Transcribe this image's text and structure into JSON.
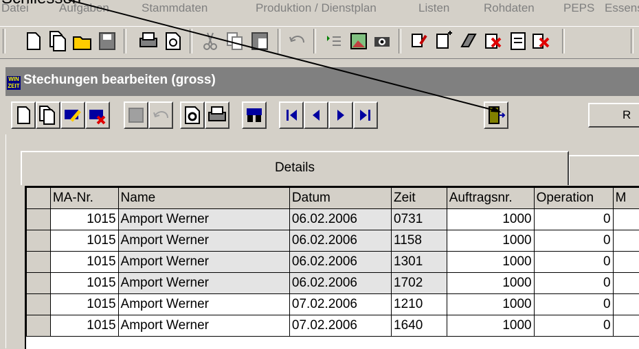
{
  "callout": "Schliessen",
  "menu": [
    "Datei",
    "Aufgaben",
    "Stammdaten",
    "Produktion / Dienstplan",
    "Listen",
    "Rohdaten",
    "PEPS",
    "Essens"
  ],
  "window": {
    "logo_line1": "WIN",
    "logo_line2": "ZEIT",
    "title": "Stechungen bearbeiten (gross)"
  },
  "r_button_label": "R",
  "tab_details": "Details",
  "table": {
    "columns": [
      "",
      "MA-Nr.",
      "Name",
      "Datum",
      "Zeit",
      "Auftragsnr.",
      "Operation",
      "M"
    ],
    "rows": [
      {
        "ma": "1015",
        "name": "Amport Werner",
        "datum": "06.02.2006",
        "zeit": "0731",
        "auftrag": "1000",
        "operation": "0"
      },
      {
        "ma": "1015",
        "name": "Amport Werner",
        "datum": "06.02.2006",
        "zeit": "1158",
        "auftrag": "1000",
        "operation": "0"
      },
      {
        "ma": "1015",
        "name": "Amport Werner",
        "datum": "06.02.2006",
        "zeit": "1301",
        "auftrag": "1000",
        "operation": "0"
      },
      {
        "ma": "1015",
        "name": "Amport Werner",
        "datum": "06.02.2006",
        "zeit": "1702",
        "auftrag": "1000",
        "operation": "0"
      },
      {
        "ma": "1015",
        "name": "Amport Werner",
        "datum": "07.02.2006",
        "zeit": "1210",
        "auftrag": "1000",
        "operation": "0"
      },
      {
        "ma": "1015",
        "name": "Amport Werner",
        "datum": "07.02.2006",
        "zeit": "1640",
        "auftrag": "1000",
        "operation": "0"
      }
    ]
  },
  "toolbar_main_icons": [
    "new-document-icon",
    "copy-document-icon",
    "open-folder-icon",
    "save-icon",
    "print-icon",
    "print-preview-icon",
    "cut-icon",
    "copy-icon",
    "paste-icon",
    "undo-icon",
    "list-icon",
    "picture-icon",
    "camera-icon",
    "edit-icon",
    "add-document-icon",
    "erase-icon",
    "delete-icon",
    "document-icon",
    "delete-entry-icon"
  ],
  "toolbar_child_icons": [
    "new-record-icon",
    "copy-record-icon",
    "edit-record-icon",
    "delete-record-icon",
    "save-record-icon",
    "undo-icon",
    "preview-icon",
    "print-icon",
    "search-icon",
    "first-record-icon",
    "previous-record-icon",
    "next-record-icon",
    "last-record-icon",
    "exit-door-icon"
  ]
}
